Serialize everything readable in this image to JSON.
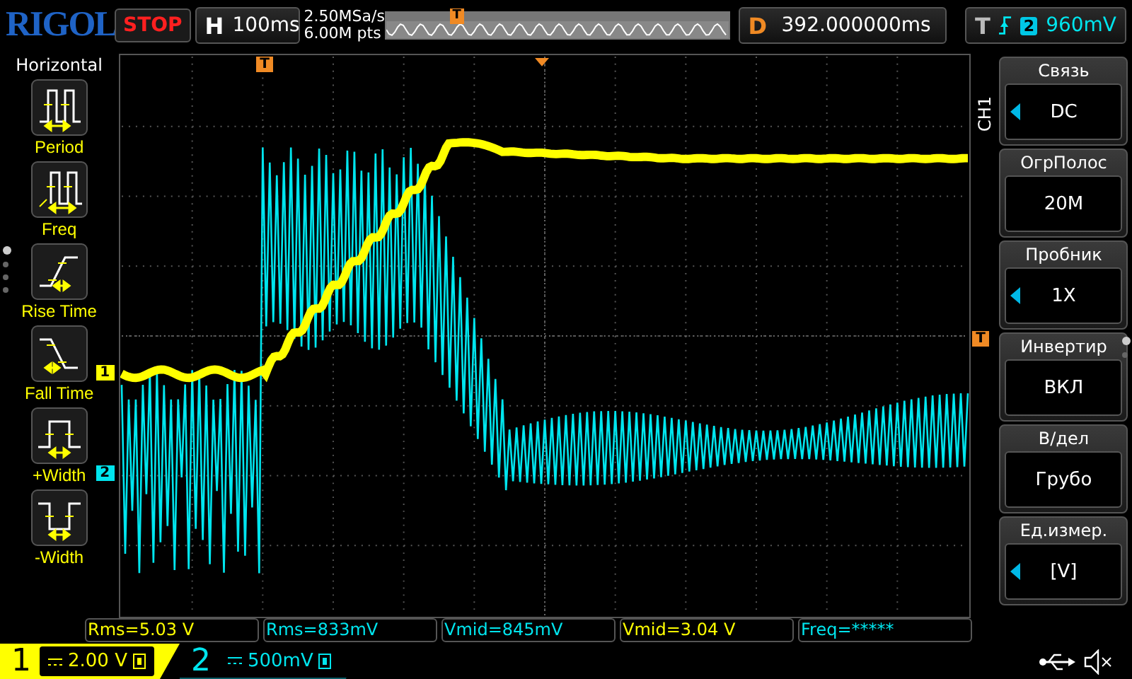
{
  "brand": "RIGOL",
  "run_state": "STOP",
  "horizontal": {
    "label": "H",
    "timebase": "100ms",
    "sample_rate": "2.50MSa/s",
    "memory_depth": "6.00M pts",
    "marker": "T"
  },
  "delay": {
    "label": "D",
    "value": "392.000000ms"
  },
  "trigger": {
    "label": "T",
    "channel": "2",
    "level": "960mV"
  },
  "left_menu": {
    "title": "Horizontal",
    "pages": [
      {
        "selected": true
      },
      {
        "selected": false
      },
      {
        "selected": false
      },
      {
        "selected": false
      }
    ],
    "items": [
      {
        "label": "Period",
        "kind": "period"
      },
      {
        "label": "Freq",
        "kind": "freq"
      },
      {
        "label": "Rise Time",
        "kind": "rise"
      },
      {
        "label": "Fall Time",
        "kind": "fall"
      },
      {
        "label": "+Width",
        "kind": "pwidth"
      },
      {
        "label": "-Width",
        "kind": "nwidth"
      }
    ]
  },
  "screen": {
    "trigger_marker": "T",
    "level_marker": "T",
    "channel_markers": [
      {
        "label": "1",
        "color": "#ffff00"
      },
      {
        "label": "2",
        "color": "#00e5ee"
      }
    ]
  },
  "channel_menu": {
    "channel": "CH1",
    "pages": [
      {
        "selected": true
      },
      {
        "selected": false
      }
    ],
    "items": [
      {
        "title": "Связь",
        "value": "DC",
        "adjustable": true
      },
      {
        "title": "ОгрПолос",
        "value": "20M",
        "adjustable": false
      },
      {
        "title": "Пробник",
        "value": "1X",
        "adjustable": true
      },
      {
        "title": "Инвертир",
        "value": "ВКЛ",
        "adjustable": false
      },
      {
        "title": "В/дел",
        "value": "Грубо",
        "adjustable": false
      },
      {
        "title": "Ед.измер.",
        "value": "[V]",
        "adjustable": true
      }
    ]
  },
  "measurements": [
    {
      "text": "Rms=5.03 V",
      "color": "#ffff00"
    },
    {
      "text": "Rms=833mV",
      "color": "#00e5ee"
    },
    {
      "text": "Vmid=845mV",
      "color": "#00e5ee"
    },
    {
      "text": "Vmid=3.04 V",
      "color": "#ffff00"
    },
    {
      "text": "Freq=*****",
      "color": "#00e5ee"
    }
  ],
  "channels": [
    {
      "number": "1",
      "scale": "2.00 V",
      "active": true
    },
    {
      "number": "2",
      "scale": "500mV",
      "active": false
    }
  ]
}
